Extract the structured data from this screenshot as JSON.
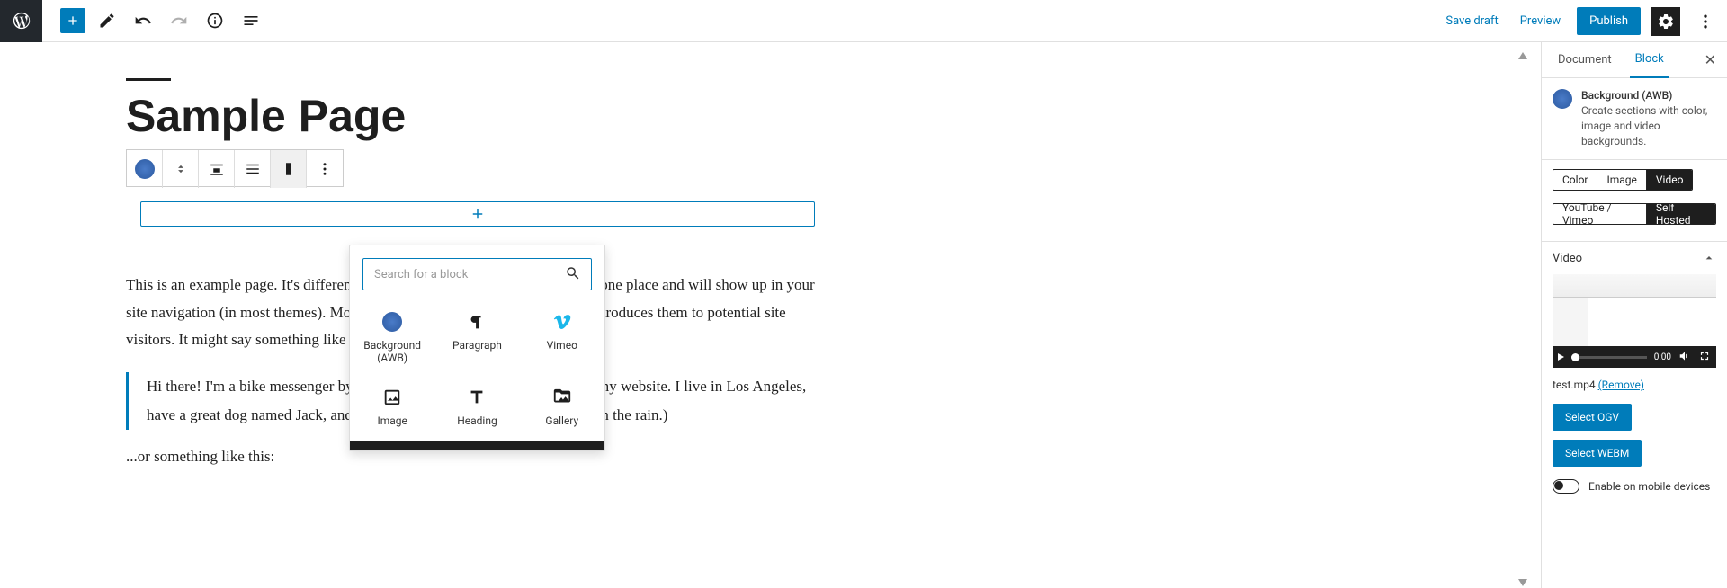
{
  "toolbar": {
    "save_draft": "Save draft",
    "preview": "Preview",
    "publish": "Publish"
  },
  "page": {
    "title": "Sample Page",
    "para1": "This is an example page. It's different from a blog post because it will stay in one place and will show up in your site navigation (in most themes). Most people start with an About page that introduces them to potential site visitors. It might say something like this:",
    "quote": "Hi there! I'm a bike messenger by day, aspiring actor by night, and this is my website. I live in Los Angeles, have a great dog named Jack, and I like piña coladas. (And gettin' caught in the rain.)",
    "para2": "...or something like this:"
  },
  "popup": {
    "search_placeholder": "Search for a block",
    "items": [
      "Background (AWB)",
      "Paragraph",
      "Vimeo",
      "Image",
      "Heading",
      "Gallery"
    ]
  },
  "sidebar": {
    "tabs": {
      "document": "Document",
      "block": "Block"
    },
    "block_title": "Background (AWB)",
    "block_desc": "Create sections with color, image and video backgrounds.",
    "type_pills": [
      "Color",
      "Image",
      "Video"
    ],
    "source_pills": [
      "YouTube / Vimeo",
      "Self Hosted"
    ],
    "video_panel": "Video",
    "video_time": "0:00",
    "file_name": "test.mp4",
    "remove": "(Remove)",
    "select_ogv": "Select OGV",
    "select_webm": "Select WEBM",
    "enable_mobile": "Enable on mobile devices"
  }
}
